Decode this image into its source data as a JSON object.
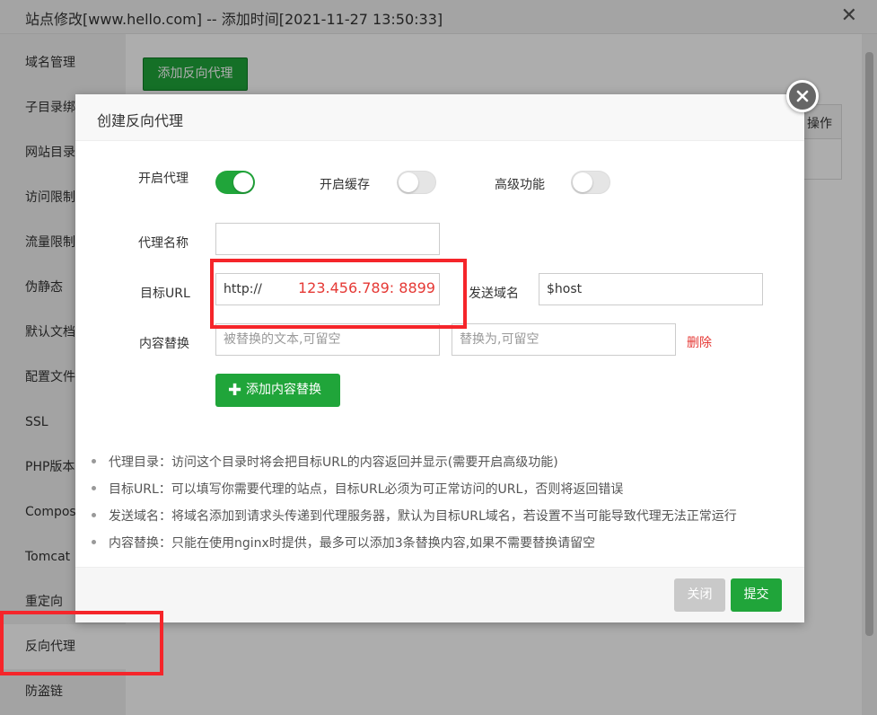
{
  "outer": {
    "title": "站点修改[www.hello.com] -- 添加时间[2021-11-27 13:50:33]",
    "close_glyph": "✕",
    "sidebar": [
      {
        "label": "域名管理"
      },
      {
        "label": "子目录绑定"
      },
      {
        "label": "网站目录"
      },
      {
        "label": "访问限制"
      },
      {
        "label": "流量限制"
      },
      {
        "label": "伪静态"
      },
      {
        "label": "默认文档"
      },
      {
        "label": "配置文件"
      },
      {
        "label": "SSL"
      },
      {
        "label": "PHP版本"
      },
      {
        "label": "Composer"
      },
      {
        "label": "Tomcat"
      },
      {
        "label": "重定向"
      },
      {
        "label": "反向代理"
      },
      {
        "label": "防盗链"
      }
    ],
    "add_proxy_button": "添加反向代理",
    "table_op_header": "操作"
  },
  "modal": {
    "title": "创建反向代理",
    "toggles": {
      "enable_proxy": {
        "label": "开启代理",
        "on": true
      },
      "enable_cache": {
        "label": "开启缓存",
        "on": false
      },
      "advanced": {
        "label": "高级功能",
        "on": false
      }
    },
    "proxy_name": {
      "label": "代理名称",
      "value": ""
    },
    "target_url": {
      "label": "目标URL",
      "value": "http://",
      "overlay": "123.456.789: 8899"
    },
    "send_domain": {
      "label": "发送域名",
      "value": "$host"
    },
    "content_replace": {
      "label": "内容替换",
      "from_placeholder": "被替换的文本,可留空",
      "to_placeholder": "替换为,可留空",
      "delete_label": "删除"
    },
    "add_replace_button": {
      "icon": "✚",
      "label": "添加内容替换"
    },
    "notes": [
      "代理目录：访问这个目录时将会把目标URL的内容返回并显示(需要开启高级功能)",
      "目标URL：可以填写你需要代理的站点，目标URL必须为可正常访问的URL，否则将返回错误",
      "发送域名：将域名添加到请求头传递到代理服务器，默认为目标URL域名，若设置不当可能导致代理无法正常运行",
      "内容替换：只能在使用nginx时提供，最多可以添加3条替换内容,如果不需要替换请留空"
    ],
    "footer": {
      "close_label": "关闭",
      "submit_label": "提交"
    }
  },
  "colors": {
    "primary_green": "#20a53a",
    "highlight_red": "#f5252a",
    "delete_red": "#e53935"
  }
}
